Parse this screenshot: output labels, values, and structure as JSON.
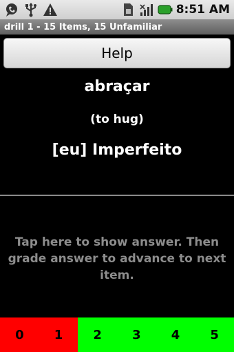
{
  "status_bar": {
    "icons": [
      "talk-bubble-icon",
      "usb-icon",
      "warning-icon",
      "sim-icon",
      "signal-icon",
      "battery-icon"
    ],
    "time": "8:51 AM"
  },
  "title_bar": {
    "title": "drill 1 - 15 Items, 15 Unfamiliar"
  },
  "help_button": {
    "label": "Help"
  },
  "question": {
    "word": "abraçar",
    "meaning": "(to hug)",
    "form": "[eu] Imperfeito"
  },
  "answer_prompt": "Tap here to show answer. Then grade answer to advance to next item.",
  "grades": [
    {
      "label": "0",
      "color": "#ff0000"
    },
    {
      "label": "1",
      "color": "#ff0000"
    },
    {
      "label": "2",
      "color": "#00ff00"
    },
    {
      "label": "3",
      "color": "#00ff00"
    },
    {
      "label": "4",
      "color": "#00ff00"
    },
    {
      "label": "5",
      "color": "#00ff00"
    }
  ]
}
